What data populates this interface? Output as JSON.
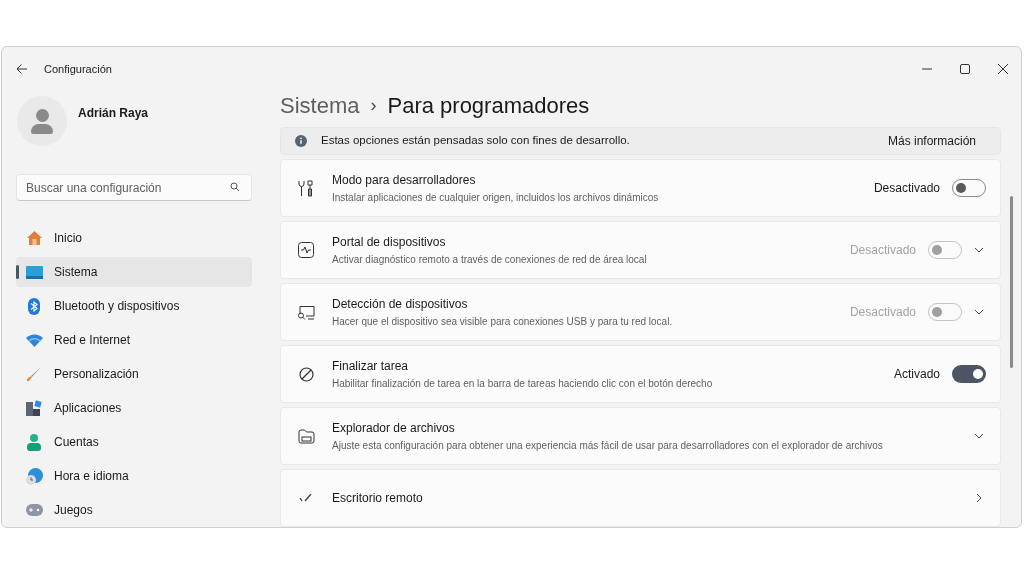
{
  "window": {
    "title": "Configuración"
  },
  "user": {
    "name": "Adrián Raya"
  },
  "search": {
    "placeholder": "Buscar una configuración"
  },
  "nav": [
    {
      "label": "Inicio",
      "selected": false
    },
    {
      "label": "Sistema",
      "selected": true
    },
    {
      "label": "Bluetooth y dispositivos",
      "selected": false
    },
    {
      "label": "Red e Internet",
      "selected": false
    },
    {
      "label": "Personalización",
      "selected": false
    },
    {
      "label": "Aplicaciones",
      "selected": false
    },
    {
      "label": "Cuentas",
      "selected": false
    },
    {
      "label": "Hora e idioma",
      "selected": false
    },
    {
      "label": "Juegos",
      "selected": false
    }
  ],
  "breadcrumb": {
    "parent": "Sistema",
    "separator": "›",
    "current": "Para programadores"
  },
  "info_bar": {
    "text": "Estas opciones están pensadas solo con fines de desarrollo.",
    "link": "Más información"
  },
  "settings": [
    {
      "kind": "toggle",
      "title": "Modo para desarrolladores",
      "description": "Instalar aplicaciones de cualquier origen, incluidos los archivos dinámicos",
      "toggle": {
        "label": "Desactivado",
        "on": false,
        "disabled": false
      }
    },
    {
      "kind": "toggle_expand",
      "title": "Portal de dispositivos",
      "description": "Activar diagnóstico remoto a través de conexiones de red de área local",
      "toggle": {
        "label": "Desactivado",
        "on": false,
        "disabled": true
      }
    },
    {
      "kind": "toggle_expand",
      "title": "Detección de dispositivos",
      "description": "Hacer que el dispositivo sea visible para conexiones USB y para tu red local.",
      "toggle": {
        "label": "Desactivado",
        "on": false,
        "disabled": true
      }
    },
    {
      "kind": "toggle",
      "title": "Finalizar tarea",
      "description": "Habilitar finalización de tarea en la barra de tareas haciendo clic con el botón derecho",
      "toggle": {
        "label": "Activado",
        "on": true,
        "disabled": false
      }
    },
    {
      "kind": "expand",
      "title": "Explorador de archivos",
      "description": "Ajuste esta configuración para obtener una experiencia más fácil de usar para desarrolladores con el explorador de archivos"
    },
    {
      "kind": "link",
      "title": "Escritorio remoto"
    }
  ]
}
